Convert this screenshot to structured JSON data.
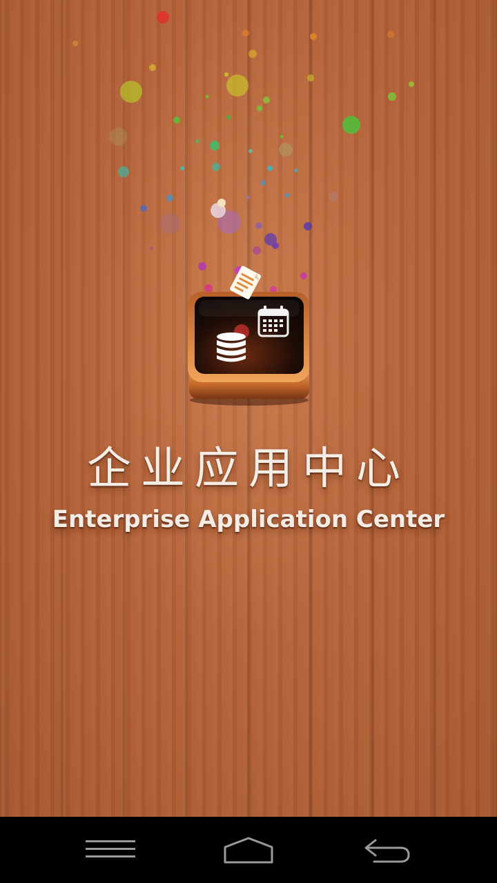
{
  "app": {
    "title_cn": "企业应用中心",
    "title_en": "Enterprise Application Center"
  },
  "splash": {
    "icon_name": "enterprise-app-center-logo",
    "icon_glyphs": [
      "database-icon",
      "calendar-icon",
      "document-icon"
    ]
  },
  "navigation_bar": {
    "buttons": [
      {
        "name": "menu",
        "icon": "menu-lines-icon"
      },
      {
        "name": "home",
        "icon": "home-outline-icon"
      },
      {
        "name": "back",
        "icon": "back-arrow-icon"
      }
    ]
  },
  "colors": {
    "wood_base": "#b46238",
    "nav_bar": "#000000",
    "title_text": "#f4ede6"
  }
}
